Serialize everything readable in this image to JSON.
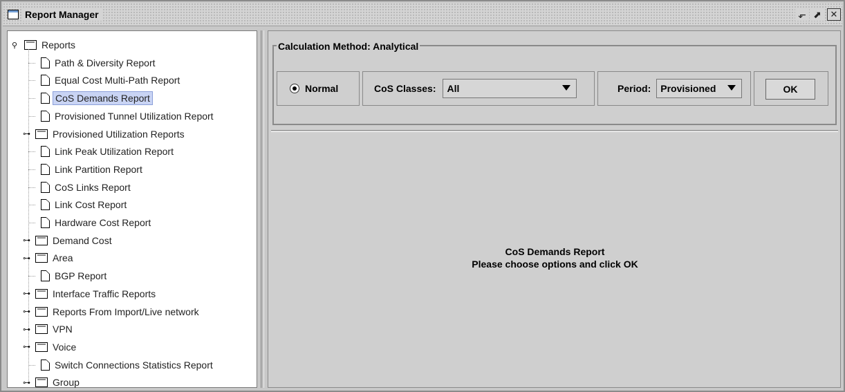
{
  "window": {
    "title": "Report Manager",
    "controls": {
      "restore_glyph": "⬐",
      "maximize_glyph": "⬈",
      "close_glyph": "✕"
    }
  },
  "tree": {
    "root_label": "Reports",
    "items": [
      {
        "label": "Path & Diversity Report",
        "type": "doc"
      },
      {
        "label": "Equal Cost Multi-Path Report",
        "type": "doc"
      },
      {
        "label": "CoS Demands Report",
        "type": "doc",
        "selected": true
      },
      {
        "label": "Provisioned Tunnel Utilization Report",
        "type": "doc"
      },
      {
        "label": "Provisioned Utilization Reports",
        "type": "folder"
      },
      {
        "label": "Link Peak Utilization Report",
        "type": "doc"
      },
      {
        "label": "Link Partition Report",
        "type": "doc"
      },
      {
        "label": "CoS Links Report",
        "type": "doc"
      },
      {
        "label": "Link Cost Report",
        "type": "doc"
      },
      {
        "label": "Hardware Cost Report",
        "type": "doc"
      },
      {
        "label": "Demand Cost",
        "type": "folder"
      },
      {
        "label": "Area",
        "type": "folder"
      },
      {
        "label": "BGP Report",
        "type": "doc"
      },
      {
        "label": "Interface Traffic Reports",
        "type": "folder"
      },
      {
        "label": "Reports From Import/Live network",
        "type": "folder"
      },
      {
        "label": "VPN",
        "type": "folder"
      },
      {
        "label": "Voice",
        "type": "folder"
      },
      {
        "label": "Switch Connections Statistics Report",
        "type": "doc"
      },
      {
        "label": "Group",
        "type": "folder"
      }
    ]
  },
  "options": {
    "group_title": "Calculation Method: Analytical",
    "normal_label": "Normal",
    "cos_classes_label": "CoS Classes:",
    "cos_classes_value": "All",
    "period_label": "Period:",
    "period_value": "Provisioned",
    "ok_label": "OK"
  },
  "message": {
    "line1": "CoS Demands Report",
    "line2": "Please choose options and click OK"
  }
}
